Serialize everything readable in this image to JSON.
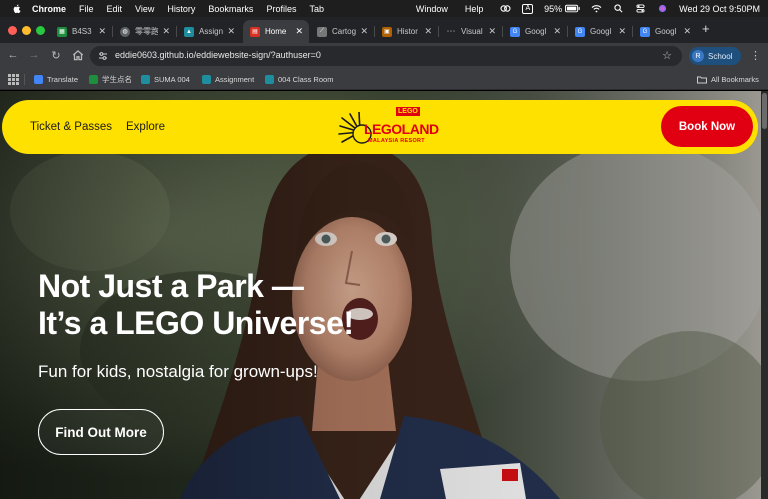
{
  "menubar": {
    "items": [
      "Chrome",
      "File",
      "Edit",
      "View",
      "History",
      "Bookmarks",
      "Profiles",
      "Tab",
      "Window",
      "Help"
    ],
    "battery": "95%",
    "keyboard_indicator": "A",
    "datetime": "Wed 29 Oct  9:50PM"
  },
  "tabs": [
    {
      "label": "B4S3",
      "favicon": "sheets-icon",
      "color": "#1e8e3e"
    },
    {
      "label": "零零跑",
      "favicon": "globe-icon",
      "color": "#5f6368"
    },
    {
      "label": "Assign",
      "favicon": "classroom-icon",
      "color": "#1e8e9e"
    },
    {
      "label": "Home",
      "favicon": "page-icon",
      "color": "#d93025"
    },
    {
      "label": "Cartog",
      "favicon": "slash-icon",
      "color": "#888888"
    },
    {
      "label": "Histor",
      "favicon": "history-icon",
      "color": "#b06000"
    },
    {
      "label": "Visual",
      "favicon": "dots-icon",
      "color": "#888888"
    },
    {
      "label": "Googl",
      "favicon": "translate-icon",
      "color": "#4285f4"
    },
    {
      "label": "Googl",
      "favicon": "translate-icon",
      "color": "#4285f4"
    },
    {
      "label": "Googl",
      "favicon": "translate-icon",
      "color": "#4285f4"
    }
  ],
  "toolbar": {
    "url": "eddie0603.github.io/eddiewebsite-sign/?authuser=0",
    "profile_initial": "R",
    "profile_label": "School"
  },
  "bookmarks": {
    "items": [
      {
        "label": "Translate",
        "color": "#4285f4"
      },
      {
        "label": "学生点名",
        "color": "#1e8e3e"
      },
      {
        "label": "SUMA 004",
        "color": "#1e8e9e"
      },
      {
        "label": "Assignment",
        "color": "#1e8e9e"
      },
      {
        "label": "004 Class Room",
        "color": "#1e8e9e"
      }
    ],
    "all_label": "All Bookmarks"
  },
  "page": {
    "nav": {
      "link1": "Ticket & Passes",
      "link2": "Explore",
      "logo_word": "LEGOLAND",
      "logo_sub": "MALAYSIA RESORT",
      "logo_badge": "LEGO",
      "book_label": "Book Now"
    },
    "hero": {
      "title_line1": "Not Just a Park —",
      "title_line2": "It’s a LEGO Universe!",
      "subtitle": "Fun for kids, nostalgia for grown-ups!",
      "cta_label": "Find Out More"
    },
    "colors": {
      "nav_yellow": "#ffe100",
      "book_red": "#e10012"
    }
  }
}
